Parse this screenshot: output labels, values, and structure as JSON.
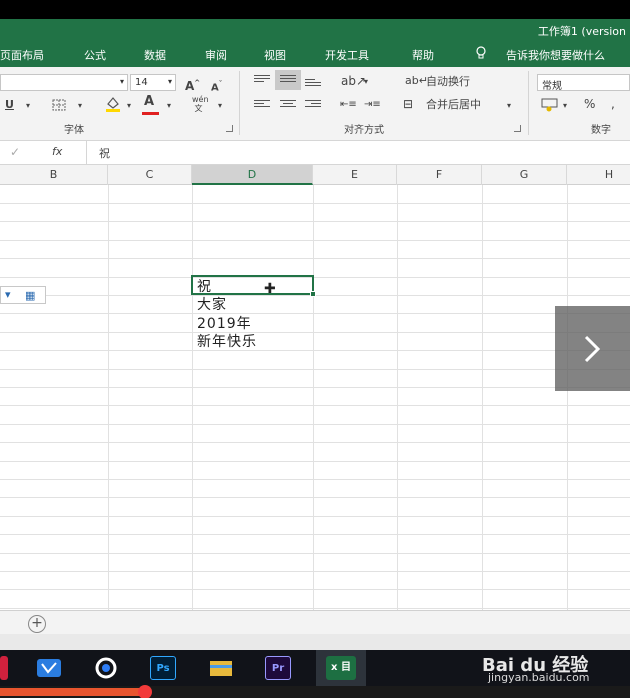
{
  "window": {
    "title": "工作簿1 (version"
  },
  "tabs": [
    {
      "label": "页面布局"
    },
    {
      "label": "公式"
    },
    {
      "label": "数据"
    },
    {
      "label": "审阅"
    },
    {
      "label": "视图"
    },
    {
      "label": "开发工具"
    },
    {
      "label": "帮助"
    },
    {
      "label": "告诉我你想要做什么"
    }
  ],
  "ribbon": {
    "font_size": "14",
    "grow_font": "A",
    "shrink_font": "A",
    "underline": "U",
    "font_color_letter": "A",
    "phonetic": "wén",
    "wrap_text": "自动换行",
    "merge_center": "合并后居中",
    "number_format": "常规",
    "percent": "%",
    "groups": {
      "font": "字体",
      "alignment": "对齐方式",
      "number": "数字"
    }
  },
  "formula_bar": {
    "fx": "fx",
    "content": "祝"
  },
  "grid": {
    "columns": [
      "B",
      "C",
      "D",
      "E",
      "F",
      "G",
      "H"
    ],
    "selected_column": "D",
    "cells": [
      "祝",
      "大家",
      "2019年",
      "新年快乐"
    ]
  },
  "sheet_bar": {
    "add_label": "+"
  },
  "taskbar": {
    "apps": [
      {
        "name": "Ps"
      },
      {
        "name": "Pr"
      },
      {
        "name": "x 目"
      }
    ]
  },
  "watermark": {
    "brand": "Bai du 经验",
    "url": "jingyan.baidu.com"
  },
  "video": {
    "progress": 0.23
  },
  "colors": {
    "excel_green": "#217346",
    "progress": "#e8552e"
  }
}
